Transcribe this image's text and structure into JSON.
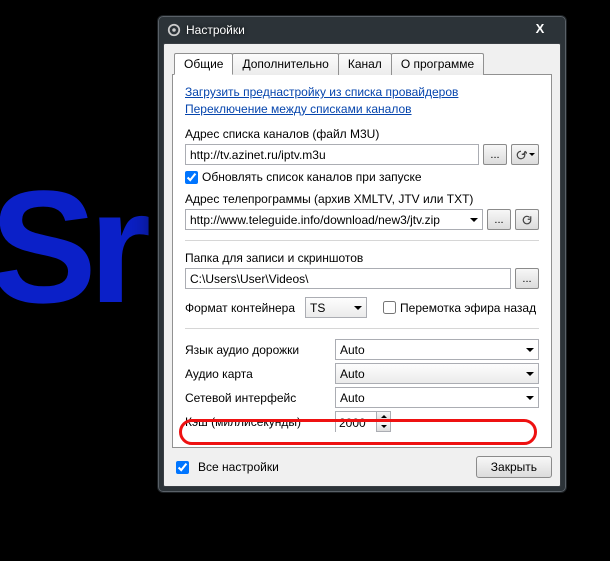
{
  "bg_text": "Sr",
  "window": {
    "title": "Настройки"
  },
  "tabs": [
    "Общие",
    "Дополнительно",
    "Канал",
    "О программе"
  ],
  "links": {
    "preset": "Загрузить преднастройку из списка провайдеров",
    "switch": "Переключение между списками каналов"
  },
  "channels": {
    "label": "Адрес списка каналов (файл M3U)",
    "value": "http://tv.azinet.ru/iptv.m3u",
    "update_label": "Обновлять список каналов при запуске",
    "update_checked": true
  },
  "epg": {
    "label": "Адрес телепрограммы (архив XMLTV, JTV или TXT)",
    "value": "http://www.teleguide.info/download/new3/jtv.zip"
  },
  "folder": {
    "label": "Папка для записи и скриншотов",
    "value": "C:\\Users\\User\\Videos\\"
  },
  "container": {
    "label": "Формат контейнера",
    "value": "TS",
    "rewind_label": "Перемотка эфира назад",
    "rewind_checked": false
  },
  "audio_track": {
    "label": "Язык аудио дорожки",
    "value": "Auto"
  },
  "audio_card": {
    "label": "Аудио карта",
    "value": "Auto"
  },
  "net_if": {
    "label": "Сетевой интерфейс",
    "value": "Auto"
  },
  "cache": {
    "label": "Кэш (миллисекунды)",
    "value": "2000"
  },
  "footer": {
    "all_label": "Все настройки",
    "all_checked": true,
    "close": "Закрыть"
  }
}
